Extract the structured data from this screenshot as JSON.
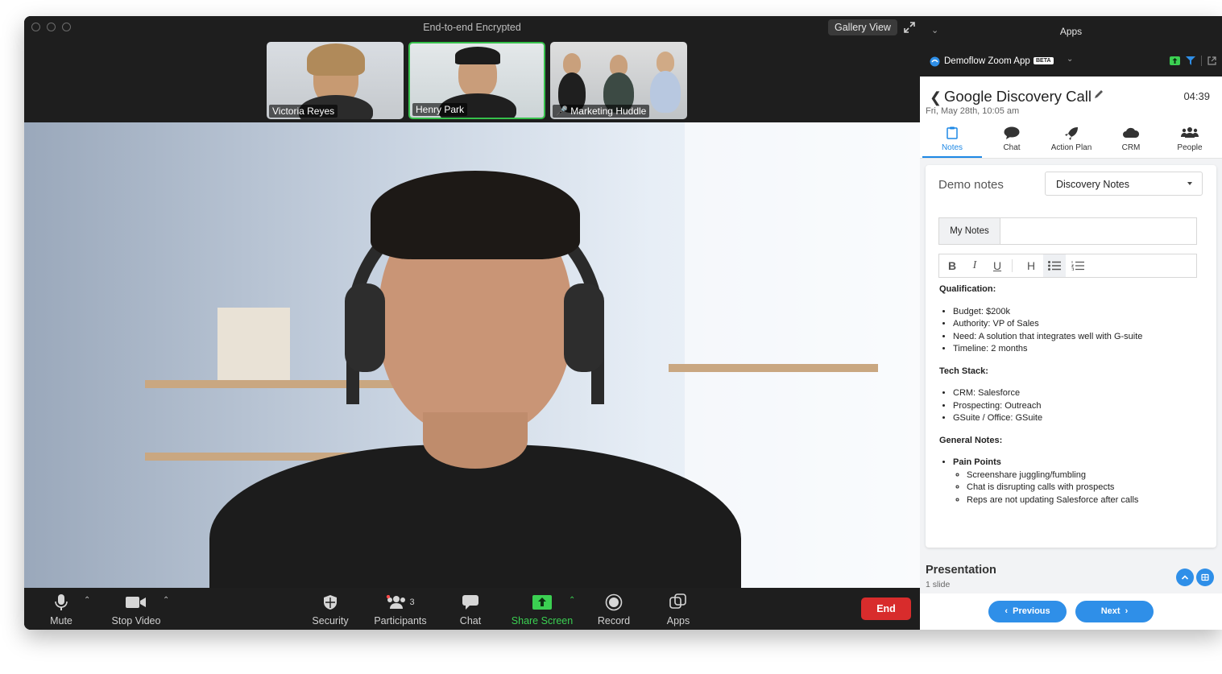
{
  "window": {
    "title": "End-to-end Encrypted",
    "gallery_view_label": "Gallery View"
  },
  "participants_strip": [
    {
      "name": "Victoria Reyes"
    },
    {
      "name": "Henry Park"
    },
    {
      "name": "Marketing Huddle"
    }
  ],
  "controls": {
    "mute": "Mute",
    "stop_video": "Stop Video",
    "security": "Security",
    "participants": "Participants",
    "participants_count": "3",
    "chat": "Chat",
    "share_screen": "Share Screen",
    "record": "Record",
    "apps": "Apps",
    "end": "End"
  },
  "side_panel": {
    "header_title": "Apps",
    "app_name": "Demoflow Zoom App",
    "app_badge": "BETA",
    "meeting_title": "Google Discovery Call",
    "timer": "04:39",
    "date": "Fri, May 28th, 10:05 am",
    "tabs": [
      {
        "label": "Notes",
        "icon": "clipboard-icon"
      },
      {
        "label": "Chat",
        "icon": "chat-bubble-icon"
      },
      {
        "label": "Action Plan",
        "icon": "rocket-icon"
      },
      {
        "label": "CRM",
        "icon": "cloud-icon"
      },
      {
        "label": "People",
        "icon": "people-icon"
      }
    ],
    "demo_notes_label": "Demo notes",
    "notes_template": "Discovery Notes",
    "my_notes_tab": "My Notes",
    "notes": {
      "qualification_heading": "Qualification:",
      "qualification": [
        "Budget: $200k",
        "Authority: VP of Sales",
        "Need: A solution that integrates well with G-suite",
        "Timeline: 2 months"
      ],
      "tech_stack_heading": "Tech Stack:",
      "tech_stack": [
        "CRM: Salesforce",
        "Prospecting: Outreach",
        "GSuite / Office: GSuite"
      ],
      "general_heading": "General Notes:",
      "pain_points_label": "Pain Points",
      "pain_points": [
        "Screenshare juggling/fumbling",
        "Chat is disrupting calls with prospects",
        "Reps are not updating Salesforce after calls"
      ]
    },
    "presentation_title": "Presentation",
    "presentation_sub": "1 slide",
    "previous_label": "Previous",
    "next_label": "Next"
  },
  "colors": {
    "accent_blue": "#2f8fe8",
    "end_red": "#d82c2c",
    "share_green": "#3bd052"
  }
}
